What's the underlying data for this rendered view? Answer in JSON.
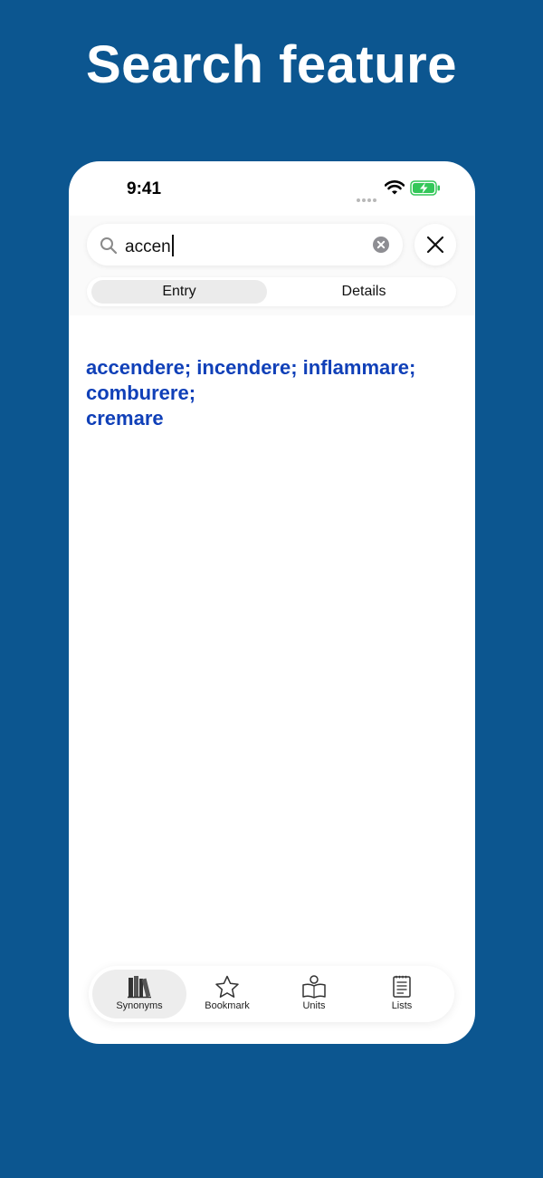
{
  "headline": "Search feature",
  "status": {
    "time": "9:41"
  },
  "search": {
    "value": "accen"
  },
  "segments": [
    {
      "label": "Entry",
      "selected": true
    },
    {
      "label": "Details",
      "selected": false
    }
  ],
  "result": {
    "lines": [
      "accendere; incendere; inflammare;",
      "comburere;",
      "cremare"
    ],
    "color": "#1040b8"
  },
  "tabbar": [
    {
      "label": "Synonyms",
      "icon": "books-icon",
      "active": true
    },
    {
      "label": "Bookmark",
      "icon": "star-icon",
      "active": false
    },
    {
      "label": "Units",
      "icon": "reader-icon",
      "active": false
    },
    {
      "label": "Lists",
      "icon": "list-icon",
      "active": false
    }
  ],
  "colors": {
    "background": "#0c5690",
    "accent": "#1040b8",
    "battery": "#34c759"
  }
}
